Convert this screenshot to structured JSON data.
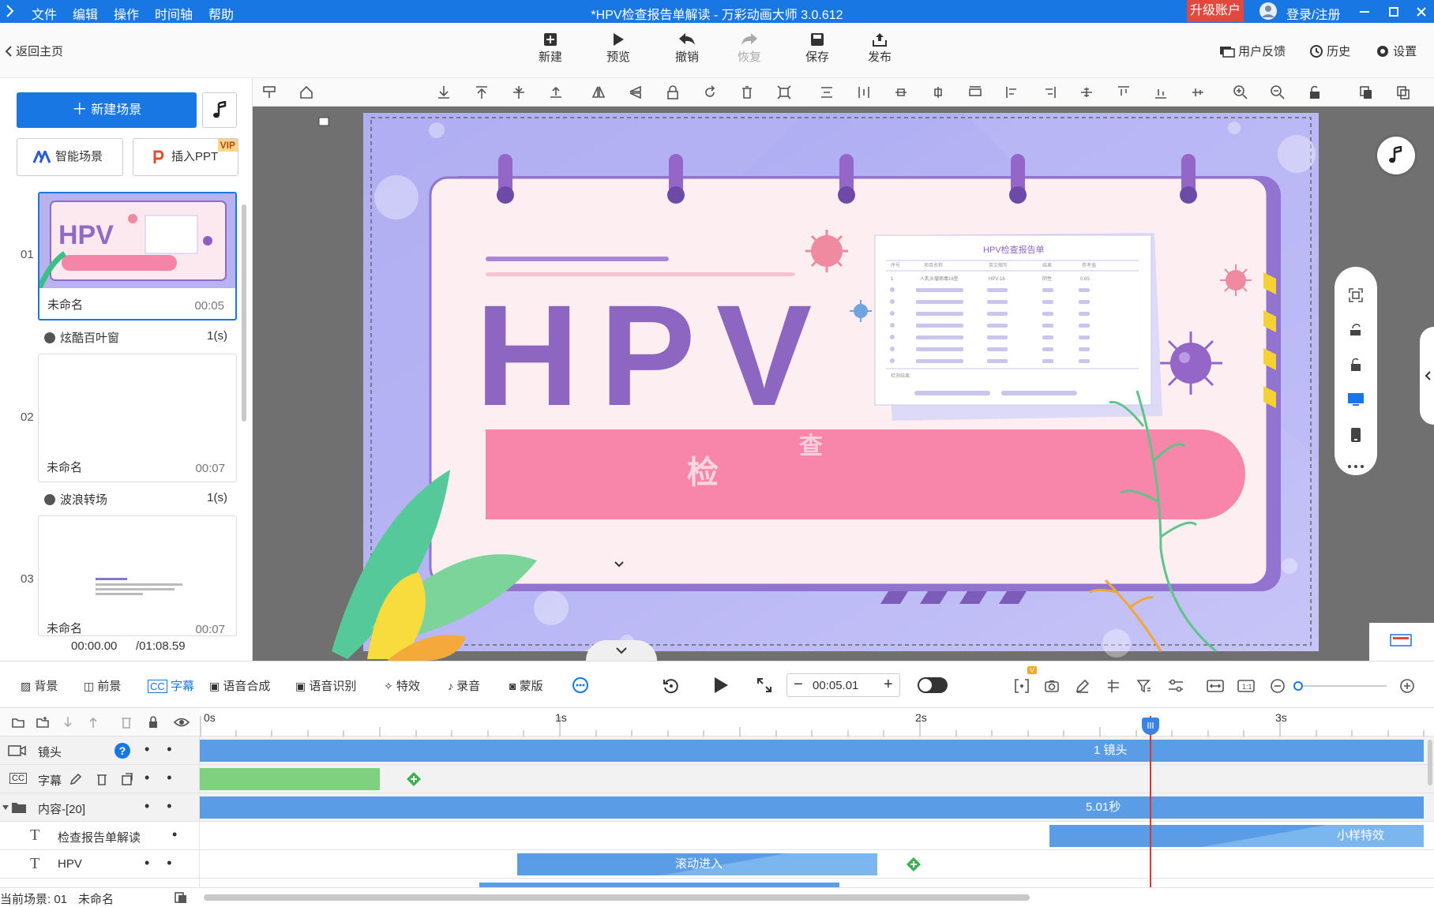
{
  "window": {
    "title": "*HPV检查报告单解读 - 万彩动画大师 3.0.612"
  },
  "menubar": {
    "items": [
      "文件",
      "编辑",
      "操作",
      "时间轴",
      "帮助"
    ]
  },
  "account": {
    "upgrade": "升级账户",
    "login": "登录/注册"
  },
  "toolbar": {
    "back": "返回主页",
    "new": "新建",
    "preview": "预览",
    "undo": "撤销",
    "redo": "恢复",
    "save": "保存",
    "publish": "发布",
    "feedback": "用户反馈",
    "history": "历史",
    "settings": "设置"
  },
  "sidebar": {
    "new_scene": "新建场景",
    "smart_scene": "智能场景",
    "insert_ppt": "插入PPT",
    "vip": "VIP",
    "scenes": [
      {
        "num": "01",
        "name": "未命名",
        "duration": "00:05"
      },
      {
        "num": "02",
        "name": "未命名",
        "duration": "00:07"
      },
      {
        "num": "03",
        "name": "未命名",
        "duration": "00:07"
      }
    ],
    "transitions": [
      {
        "name": "炫酷百叶窗",
        "duration": "1(s)"
      },
      {
        "name": "波浪转场",
        "duration": "1(s)"
      }
    ],
    "thumb_title": "HPV",
    "thumb_sub": "检",
    "time_current": "00:00.00",
    "time_total": "/01:08.59"
  },
  "canvas": {
    "title": "HPV",
    "subtitle_chars": [
      "检",
      "查"
    ],
    "report_title": "HPV检查报告单",
    "report_cols": [
      "序号",
      "项目名称",
      "英文缩写",
      "结果",
      "参考值"
    ],
    "report_row": [
      "1",
      "人乳头瘤病毒16型",
      "HPV-16",
      "阴性",
      "0.65"
    ],
    "report_footer": "检测结果:",
    "camera_label": "1 镜头"
  },
  "bottombar": {
    "items": [
      "背景",
      "前景",
      "字幕",
      "语音合成",
      "语音识别",
      "特效",
      "录音",
      "蒙版"
    ],
    "time": "00:05.01",
    "v_badge": "V"
  },
  "timeline": {
    "ticks": [
      "0s",
      "1s",
      "2s",
      "3s"
    ],
    "tracks": [
      {
        "name": "镜头",
        "bar": "1 镜头"
      },
      {
        "name": "字幕",
        "bar": ""
      },
      {
        "name": "内容-[20]",
        "bar": "5.01秒"
      },
      {
        "name": "检查报告单解读",
        "bar": "小样特效"
      },
      {
        "name": "HPV",
        "bar": "滚动进入"
      }
    ],
    "help": "?",
    "status_scene": "当前场景: 01",
    "status_name": "未命名"
  }
}
